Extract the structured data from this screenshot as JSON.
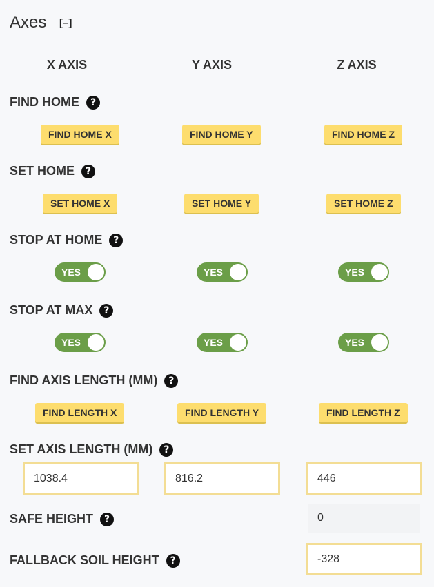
{
  "header": {
    "title": "Axes",
    "collapse_label": "[–]"
  },
  "columns": [
    "X AXIS",
    "Y AXIS",
    "Z AXIS"
  ],
  "rows": {
    "find_home": {
      "label": "FIND HOME",
      "buttons": [
        "FIND HOME X",
        "FIND HOME Y",
        "FIND HOME Z"
      ]
    },
    "set_home": {
      "label": "SET HOME",
      "buttons": [
        "SET HOME X",
        "SET HOME Y",
        "SET HOME Z"
      ]
    },
    "stop_at_home": {
      "label": "STOP AT HOME",
      "toggles": [
        "YES",
        "YES",
        "YES"
      ]
    },
    "stop_at_max": {
      "label": "STOP AT MAX",
      "toggles": [
        "YES",
        "YES",
        "YES"
      ]
    },
    "find_axis_length": {
      "label": "FIND AXIS LENGTH (MM)",
      "buttons": [
        "FIND LENGTH X",
        "FIND LENGTH Y",
        "FIND LENGTH Z"
      ]
    },
    "set_axis_length": {
      "label": "SET AXIS LENGTH (MM)",
      "values": [
        "1038.4",
        "816.2",
        "446"
      ]
    },
    "safe_height": {
      "label": "SAFE HEIGHT",
      "value": "0"
    },
    "fallback_soil_height": {
      "label": "FALLBACK SOIL HEIGHT",
      "value": "-328"
    }
  },
  "help_icon": "?",
  "colors": {
    "button_yellow": "#fddd6e",
    "toggle_green": "#6b9e48",
    "input_border": "#f3dd94",
    "background": "#f7f8fa"
  }
}
